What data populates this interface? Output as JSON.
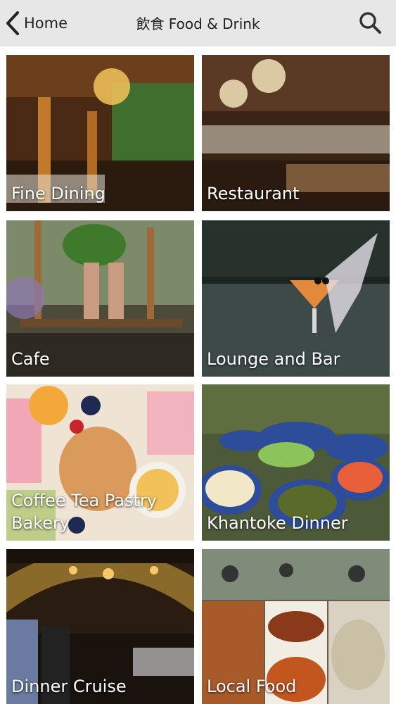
{
  "header": {
    "back_label": "Home",
    "title": "飲食 Food & Drink"
  },
  "tiles": [
    {
      "label": "Fine Dining"
    },
    {
      "label": "Restaurant"
    },
    {
      "label": "Cafe"
    },
    {
      "label": "Lounge and Bar"
    },
    {
      "label": "Coffee Tea Pastry\nBakery"
    },
    {
      "label": "Khantoke Dinner"
    },
    {
      "label": "Dinner Cruise"
    },
    {
      "label": "Local Food"
    }
  ],
  "colors": {
    "header_bg": "#e7e7e7",
    "caption_text": "#ffffff"
  }
}
